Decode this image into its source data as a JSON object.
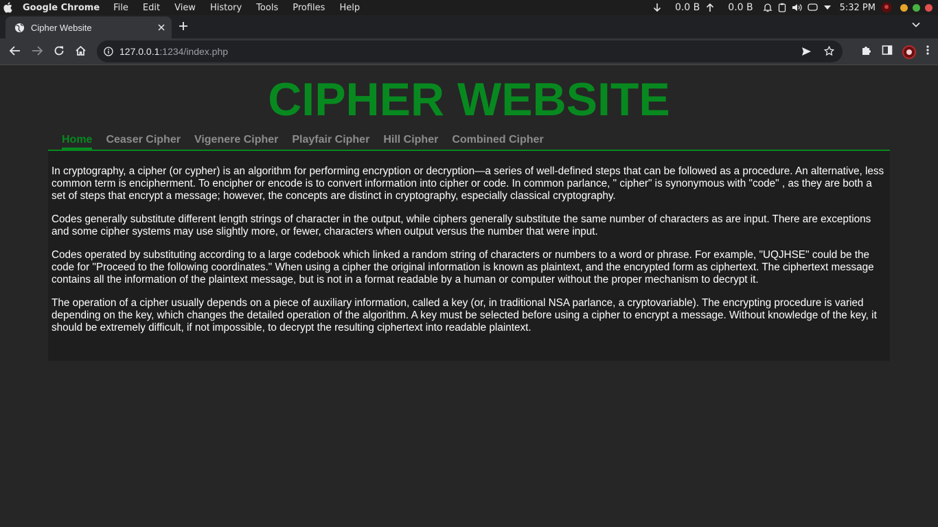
{
  "menubar": {
    "app_name": "Google Chrome",
    "items": [
      "File",
      "Edit",
      "View",
      "History",
      "Tools",
      "Profiles",
      "Help"
    ],
    "net_down": "0.0 B",
    "net_up": "0.0 B",
    "clock": "5:32 PM"
  },
  "tab": {
    "title": "Cipher Website"
  },
  "omnibox": {
    "url_host": "127.0.0.1",
    "url_rest": ":1234/index.php"
  },
  "site": {
    "title": "CIPHER WEBSITE",
    "nav": [
      "Home",
      "Ceaser Cipher",
      "Vigenere Cipher",
      "Playfair Cipher",
      "Hill Cipher",
      "Combined Cipher"
    ],
    "active_nav": "Home",
    "paragraphs": [
      "In cryptography, a cipher (or cypher) is an algorithm for performing encryption or decryption—a series of well-defined steps that can be followed as a procedure. An alternative, less common term is encipherment. To encipher or encode is to convert information into cipher or code. In common parlance, \" cipher\" is synonymous with \"code\" , as they are both a set of steps that encrypt a message; however, the concepts are distinct in cryptography, especially classical cryptography.",
      "Codes generally substitute different length strings of character in the output, while ciphers generally substitute the same number of characters as are input. There are exceptions and some cipher systems may use slightly more, or fewer, characters when output versus the number that were input.",
      "Codes operated by substituting according to a large codebook which linked a random string of characters or numbers to a word or phrase. For example, \"UQJHSE\" could be the code for \"Proceed to the following coordinates.\" When using a cipher the original information is known as plaintext, and the encrypted form as ciphertext. The ciphertext message contains all the information of the plaintext message, but is not in a format readable by a human or computer without the proper mechanism to decrypt it.",
      "The operation of a cipher usually depends on a piece of auxiliary information, called a key (or, in traditional NSA parlance, a cryptovariable). The encrypting procedure is varied depending on the key, which changes the detailed operation of the algorithm. A key must be selected before using a cipher to encrypt a message. Without knowledge of the key, it should be extremely difficult, if not impossible, to decrypt the resulting ciphertext into readable plaintext."
    ]
  },
  "colors": {
    "accent": "#07891f",
    "page_bg": "#262626",
    "panel_bg": "#1e1e1e",
    "nav_inactive": "#8c8c8c"
  }
}
